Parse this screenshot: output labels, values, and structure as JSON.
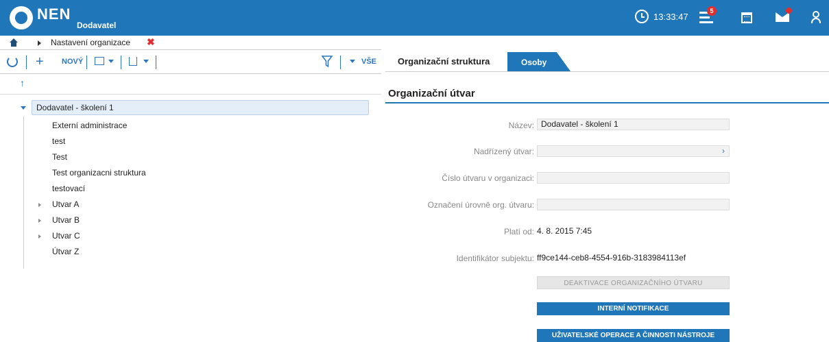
{
  "header": {
    "logo": "NEN",
    "subtitle": "Dodavatel",
    "time": "13:33:47",
    "notification_count": "5",
    "icons": [
      "clock-icon",
      "menu-icon",
      "calendar-icon",
      "mail-icon",
      "user-icon"
    ]
  },
  "breadcrumb": {
    "item": "Nastavení organizace"
  },
  "toolbar": {
    "new_label": "NOVÝ",
    "filter_label": "VŠE"
  },
  "tree": {
    "root": "Dodavatel - školení 1",
    "items": [
      {
        "label": "Externí administrace",
        "expandable": false
      },
      {
        "label": "test",
        "expandable": false
      },
      {
        "label": "Test",
        "expandable": false
      },
      {
        "label": "Test organizacni struktura",
        "expandable": false
      },
      {
        "label": "testovací",
        "expandable": false
      },
      {
        "label": "Utvar A",
        "expandable": true
      },
      {
        "label": "Utvar B",
        "expandable": true
      },
      {
        "label": "Utvar C",
        "expandable": true
      },
      {
        "label": "Útvar Z",
        "expandable": false
      }
    ]
  },
  "tabs": {
    "active": "Organizační struktura",
    "other": "Osoby"
  },
  "detail": {
    "title": "Organizační útvar",
    "fields": {
      "nazev_label": "Název:",
      "nazev_value": "Dodavatel - školení 1",
      "nadrizeny_label": "Nadřízený útvar:",
      "cislo_label": "Číslo útvaru v organizaci:",
      "oznaceni_label": "Označení úrovně org. útvaru:",
      "plati_label": "Platí od:",
      "plati_value": "4. 8. 2015 7:45",
      "ident_label": "Identifikátor subjektu:",
      "ident_value": "ff9ce144-ceb8-4554-916b-3183984113ef"
    },
    "buttons": {
      "deactivate": "DEAKTIVACE ORGANIZAČNÍHO ÚTVARU",
      "notifications": "INTERNÍ NOTIFIKACE",
      "operations": "UŽIVATELSKÉ OPERACE A ČINNOSTI NÁSTROJE"
    }
  },
  "colors": {
    "brand": "#1f76b9",
    "badge": "#e02f2f",
    "tree_selected": "#e4eef8"
  }
}
